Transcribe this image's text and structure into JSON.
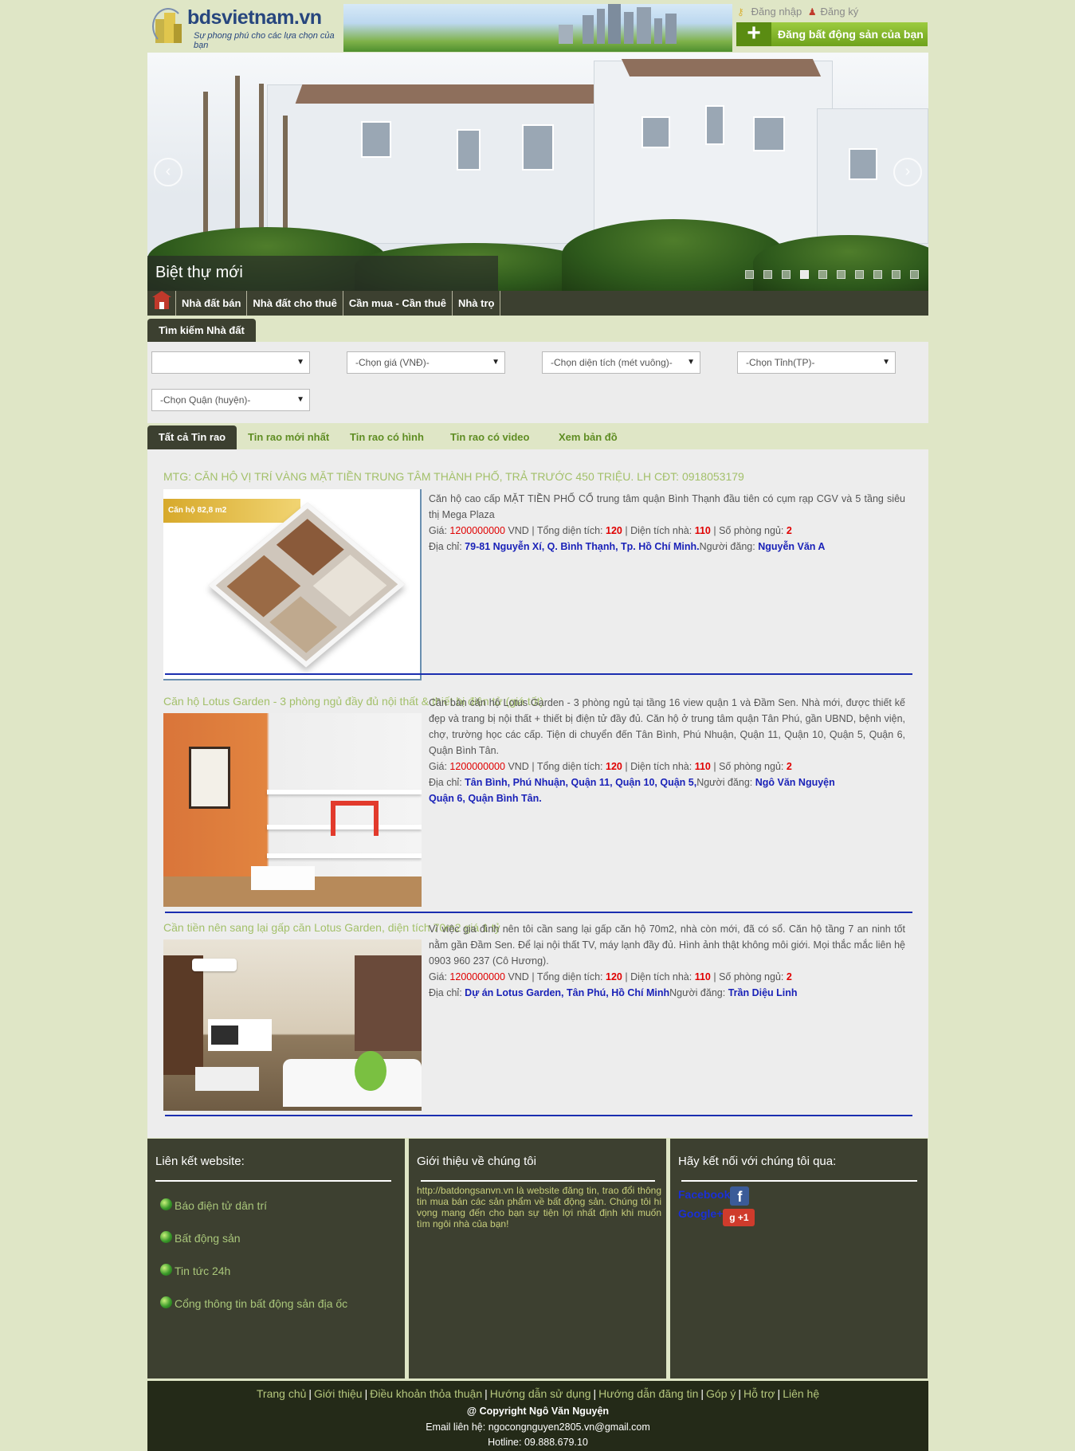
{
  "header": {
    "logo_name": "bdsvietnam.vn",
    "logo_tagline": "Sự phong phú cho các lựa chọn của bạn",
    "login": "Đăng nhập",
    "register": "Đăng ký",
    "post_button": "Đăng bất động sản của bạn",
    "post_button_icon": "plus-icon"
  },
  "slider": {
    "caption": "Biệt thự mới",
    "slide_count": 10,
    "active_slide": 3
  },
  "nav": {
    "items": [
      "Nhà đất bán",
      "Nhà đất cho thuê",
      "Cần mua - Cần thuê",
      "Nhà trọ"
    ]
  },
  "search": {
    "tab_label": "Tìm kiếm Nhà đất",
    "selects": [
      "",
      "-Chọn giá (VNĐ)-",
      "-Chọn diện tích (mét vuông)-",
      "-Chọn Tỉnh(TP)-",
      "-Chọn Quận (huyện)-"
    ]
  },
  "tabs": [
    "Tất cả Tin rao",
    "Tin rao mới nhất",
    "Tin rao có hình",
    "Tin rao có video",
    "Xem bản đồ"
  ],
  "listings": [
    {
      "title": "MTG: CĂN HỘ VỊ TRÍ VÀNG MẶT TIỀN TRUNG TÂM THÀNH PHỐ, TRẢ TRƯỚC 450 TRIỆU. LH CĐT: 0918053179",
      "image_badge": "Căn hộ 82,8 m2",
      "desc": "Căn hộ cao cấp MẶT TIỀN PHỐ CỔ trung tâm quận Bình Thạnh đầu tiên có cụm rạp CGV và 5 tầng siêu thị Mega Plaza",
      "price_label": "Giá:",
      "price": "1200000000",
      "currency": "VND",
      "area_label": "Tổng diện tích:",
      "area": "120",
      "house_area_label": "Diện tích nhà:",
      "house_area": "110",
      "rooms_label": "Số phòng ngủ:",
      "rooms": "2",
      "address_label": "Địa chỉ:",
      "address": "79-81 Nguyễn Xí, Q. Bình Thạnh, Tp. Hồ Chí Minh.",
      "poster_label": "Người đăng:",
      "poster": "Nguyễn Văn A"
    },
    {
      "title": "Căn hộ Lotus Garden - 3 phòng ngủ đầy đủ nội thất & thiết bị điện tử (giá tốt)",
      "desc": "Cần bán căn hộ Lotus Garden - 3 phòng ngủ tại tầng 16 view quận 1 và Đầm Sen. Nhà mới, được thiết kế đẹp và trang bị nội thất + thiết bị điện tử đầy đủ. Căn hộ ở trung tâm quận Tân Phú, gần UBND, bệnh viện, chợ, trường học các cấp. Tiện di chuyển đến Tân Bình, Phú Nhuận, Quận 11, Quận 10, Quận 5, Quận 6, Quận Bình Tân.",
      "price_label": "Giá:",
      "price": "1200000000",
      "currency": "VND",
      "area_label": "Tổng diện tích:",
      "area": "120",
      "house_area_label": "Diện tích nhà:",
      "house_area": "110",
      "rooms_label": "Số phòng ngủ:",
      "rooms": "2",
      "address_label": "Địa chỉ:",
      "address": "Tân Bình, Phú Nhuận, Quận 11, Quận 10, Quận 5,",
      "address_line2": "Quận 6, Quận Bình Tân.",
      "poster_label": "Người đăng:",
      "poster": "Ngô Văn Nguyện"
    },
    {
      "title": "Cần tiền nên sang lại gấp căn Lotus Garden, diện tích 70m2 giá 1 tỷ",
      "desc": "Vì việc gia đình nên tôi cần sang lại gấp căn hộ 70m2, nhà còn mới, đã có sổ. Căn hộ tầng 7 an ninh tốt nằm gần Đầm Sen. Để lại nội thất TV, máy lạnh đầy đủ. Hình ảnh thật không môi giới. Mọi thắc mắc liên hệ 0903 960 237 (Cô Hương).",
      "price_label": "Giá:",
      "price": "1200000000",
      "currency": "VND",
      "area_label": "Tổng diện tích:",
      "area": "120",
      "house_area_label": "Diện tích nhà:",
      "house_area": "110",
      "rooms_label": "Số phòng ngủ:",
      "rooms": "2",
      "address_label": "Địa chỉ:",
      "address": "Dự án Lotus Garden, Tân Phú, Hồ Chí Minh",
      "poster_label": "Người đăng:",
      "poster": "Trần Diệu Linh"
    }
  ],
  "footer": {
    "links_title": "Liên kết website:",
    "links": [
      "Báo điện tử dân trí",
      "Bất động sản",
      "Tin tức 24h",
      "Cổng thông tin bất động sản địa ốc"
    ],
    "about_title": "Giới thiệu về chúng tôi",
    "about_text": "http://batdongsanvn.vn là website đăng tin, trao đổi thông tin mua bán các sản phẩm về bất động sản. Chúng tôi hi vọng mang đến cho bạn sự tiện lợi nhất định khi muốn tìm ngôi nhà của bạn!",
    "connect_title": "Hãy kết nối với chúng tôi qua:",
    "facebook": "Facebook",
    "facebook_icon_glyph": "f",
    "google": "Google+",
    "google_icon_glyph": "g +1"
  },
  "bottom": {
    "links": [
      "Trang chủ",
      "Giới thiệu",
      "Điều khoản thỏa thuận",
      "Hướng dẫn sử dụng",
      "Hướng dẫn đăng tin",
      "Góp ý",
      "Hỗ trợ",
      "Liên hệ"
    ],
    "copyright": "@ Copyright Ngô Văn Nguyện",
    "email": "Email liên hệ: ngocongnguyen2805.vn@gmail.com",
    "hotline": "Hotline: 09.888.679.10"
  }
}
